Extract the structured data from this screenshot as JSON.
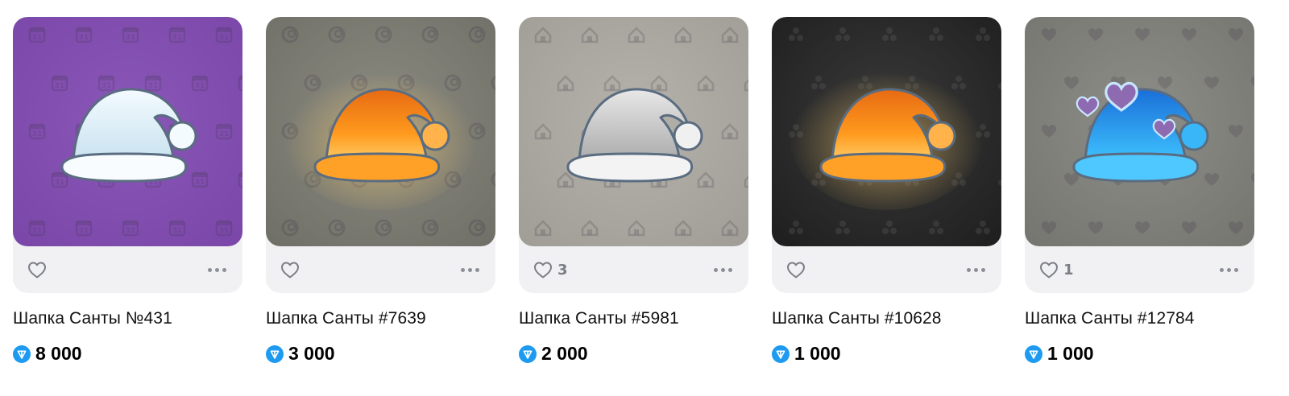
{
  "items": [
    {
      "title": "Шапка Санты №431",
      "price": "8 000",
      "likes": "",
      "background": "#8a57b8",
      "background_dark": "#7a47a8",
      "hat_style": "white",
      "pattern_icon": "calendar-icon"
    },
    {
      "title": "Шапка Санты #7639",
      "price": "3 000",
      "likes": "",
      "background": "#8a8a80",
      "background_dark": "#6f6f67",
      "hat_style": "fire",
      "pattern_icon": "swirl-icon"
    },
    {
      "title": "Шапка Санты #5981",
      "price": "2 000",
      "likes": "3",
      "background": "#b5b2ab",
      "background_dark": "#a09d96",
      "hat_style": "silver",
      "pattern_icon": "house-icon"
    },
    {
      "title": "Шапка Санты #10628",
      "price": "1 000",
      "likes": "",
      "background": "#3a3a3a",
      "background_dark": "#1e1e1e",
      "hat_style": "fire",
      "pattern_icon": "trefoil-icon"
    },
    {
      "title": "Шапка Санты #12784",
      "price": "1 000",
      "likes": "1",
      "background": "#8d8e87",
      "background_dark": "#74756f",
      "hat_style": "blue-hearts",
      "pattern_icon": "heart-icon"
    }
  ],
  "currency_icon": "ton-icon",
  "currency_color": "#1e9bf0"
}
